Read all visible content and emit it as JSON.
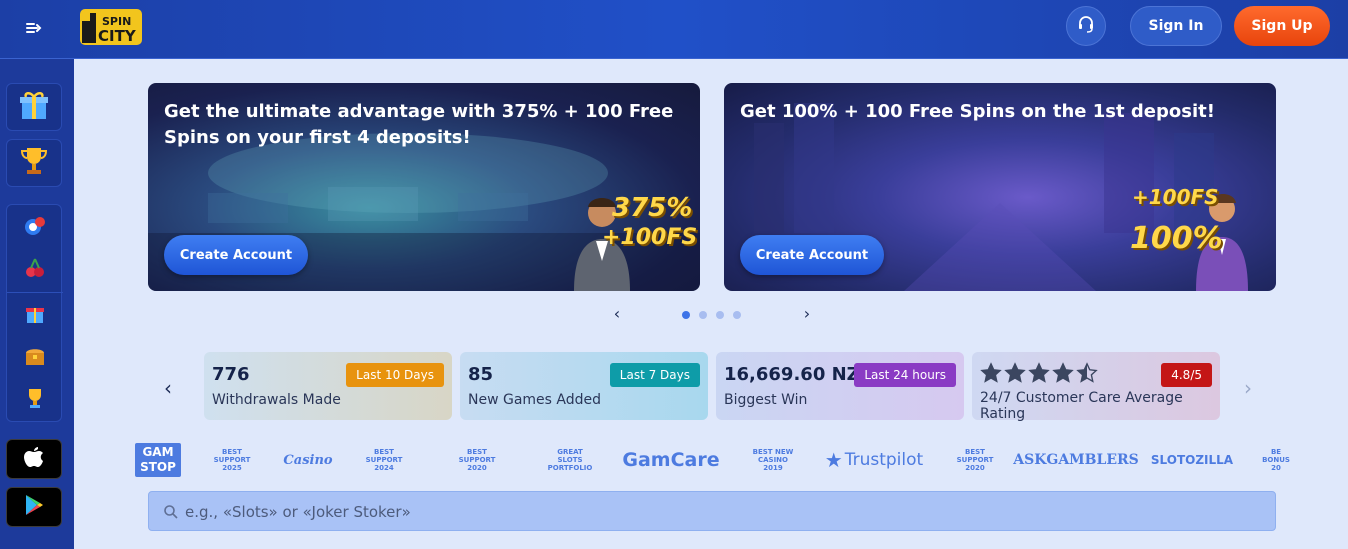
{
  "header": {
    "logo_line1": "SPIN",
    "logo_line2": "CITY",
    "sign_in": "Sign In",
    "sign_up": "Sign Up"
  },
  "sidebar": {
    "tiles": [
      "gift-icon",
      "trophy-icon"
    ],
    "group": [
      "chips-icon",
      "fruit-icon",
      "present-icon",
      "treasure-icon",
      "cup-icon"
    ],
    "stores": [
      "apple-icon",
      "google-play-icon"
    ]
  },
  "banners": [
    {
      "title": "Get the ultimate advantage with 375% + 100 Free Spins on your first 4 deposits!",
      "cta": "Create Account",
      "promo_line1": "375%",
      "promo_line2": "+100FS"
    },
    {
      "title": "Get 100% + 100 Free Spins on the 1st deposit!",
      "cta": "Create Account",
      "promo_line1": "+100FS",
      "promo_line2": "100%"
    }
  ],
  "carousel": {
    "dots": 4,
    "active": 0
  },
  "stats": [
    {
      "value": "776",
      "label": "Withdrawals Made",
      "badge": "Last 10 Days",
      "badge_color": "#e8930e"
    },
    {
      "value": "85",
      "label": "New Games Added",
      "badge": "Last 7 Days",
      "badge_color": "#0e9ca8"
    },
    {
      "value": "16,669.60 NZ$",
      "label": "Biggest Win",
      "badge": "Last 24 hours",
      "badge_color": "#8a3bc4"
    },
    {
      "value": "",
      "label": "24/7 Customer Care Average Rating",
      "badge": "4.8/5",
      "badge_color": "#c41616",
      "rating": 4.5
    }
  ],
  "partners": {
    "gamstop_1": "GAM",
    "gamstop_2": "STOP",
    "best_support_2025_1": "BEST",
    "best_support_2025_2": "SUPPORT",
    "best_support_2025_3": "2025",
    "casino_guru": "Casino",
    "best_support_2024_1": "BEST",
    "best_support_2024_2": "SUPPORT",
    "best_support_2024_3": "2024",
    "best_support_2020a_1": "BEST",
    "best_support_2020a_2": "SUPPORT",
    "best_support_2020a_3": "2020",
    "great_slots_1": "GREAT",
    "great_slots_2": "SLOTS",
    "great_slots_3": "PORTFOLIO",
    "gamcare": "GamCare",
    "best_new_1": "BEST NEW",
    "best_new_2": "CASINO",
    "best_new_3": "2019",
    "trustpilot": "Trustpilot",
    "best_support_2020b_1": "BEST",
    "best_support_2020b_2": "SUPPORT",
    "best_support_2020b_3": "2020",
    "askgamblers": "ASKGAMBLERS",
    "slotozilla": "SLOTOZILLA",
    "best_bonus_1": "BE",
    "best_bonus_2": "BONUS",
    "best_bonus_3": "20"
  },
  "search": {
    "placeholder": "e.g., «Slots» or «Joker Stoker»"
  },
  "colors": {
    "accent": "#2050c8",
    "signup": "#f0501a",
    "cta": "#2f6ae6"
  }
}
